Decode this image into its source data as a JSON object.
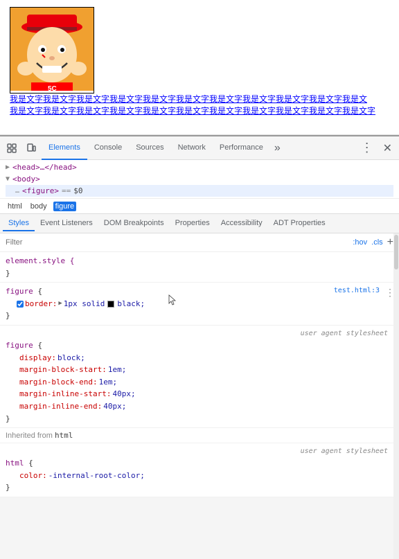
{
  "browser": {
    "content": {
      "caption": "我是文字我是文字我是文字我是文字我是文字我是文字我是文字我是文字我是文字我是文字我是文\n我是文字我是文字我是文字我是文字我是文字我是文字我是文字我是文字我是文字我是文字我是文字"
    }
  },
  "devtools": {
    "tabs": [
      {
        "label": "Elements",
        "active": true
      },
      {
        "label": "Console",
        "active": false
      },
      {
        "label": "Sources",
        "active": false
      },
      {
        "label": "Network",
        "active": false
      },
      {
        "label": "Performance",
        "active": false
      }
    ],
    "more_label": "»",
    "dots_label": "⋮",
    "close_label": "✕",
    "dom_tree": {
      "head": "<head>…</head>",
      "body": "<body>",
      "figure": "<figure> == $0"
    },
    "dom_path": [
      "html",
      "body",
      "figure"
    ],
    "styles_tabs": [
      {
        "label": "Styles",
        "active": true
      },
      {
        "label": "Event Listeners",
        "active": false
      },
      {
        "label": "DOM Breakpoints",
        "active": false
      },
      {
        "label": "Properties",
        "active": false
      },
      {
        "label": "Accessibility",
        "active": false
      },
      {
        "label": "ADT Properties",
        "active": false
      }
    ],
    "filter": {
      "placeholder": "Filter",
      "hov": ":hov",
      "cls": ".cls",
      "plus": "+"
    },
    "rules": [
      {
        "selector": "element.style",
        "source": "",
        "properties": [],
        "closing": "}"
      },
      {
        "selector": "figure",
        "source": "test.html:3",
        "properties": [
          {
            "checked": true,
            "name": "border:",
            "triangle": "▶",
            "value_parts": [
              "1px solid ",
              "black",
              ";"
            ]
          }
        ],
        "closing": "}"
      },
      {
        "selector": "figure",
        "source_label": "user agent stylesheet",
        "properties": [
          {
            "name": "display:",
            "value": "block;"
          },
          {
            "name": "margin-block-start:",
            "value": "1em;"
          },
          {
            "name": "margin-block-end:",
            "value": "1em;"
          },
          {
            "name": "margin-inline-start:",
            "value": "40px;"
          },
          {
            "name": "margin-inline-end:",
            "value": "40px;"
          }
        ],
        "closing": "}"
      }
    ],
    "inherited": {
      "label": "Inherited from",
      "tag": "html",
      "rule": {
        "selector": "html",
        "source_label": "user agent stylesheet",
        "properties": [
          {
            "name": "color:",
            "value": "-internal-root-color;"
          }
        ],
        "closing": "}"
      }
    }
  }
}
